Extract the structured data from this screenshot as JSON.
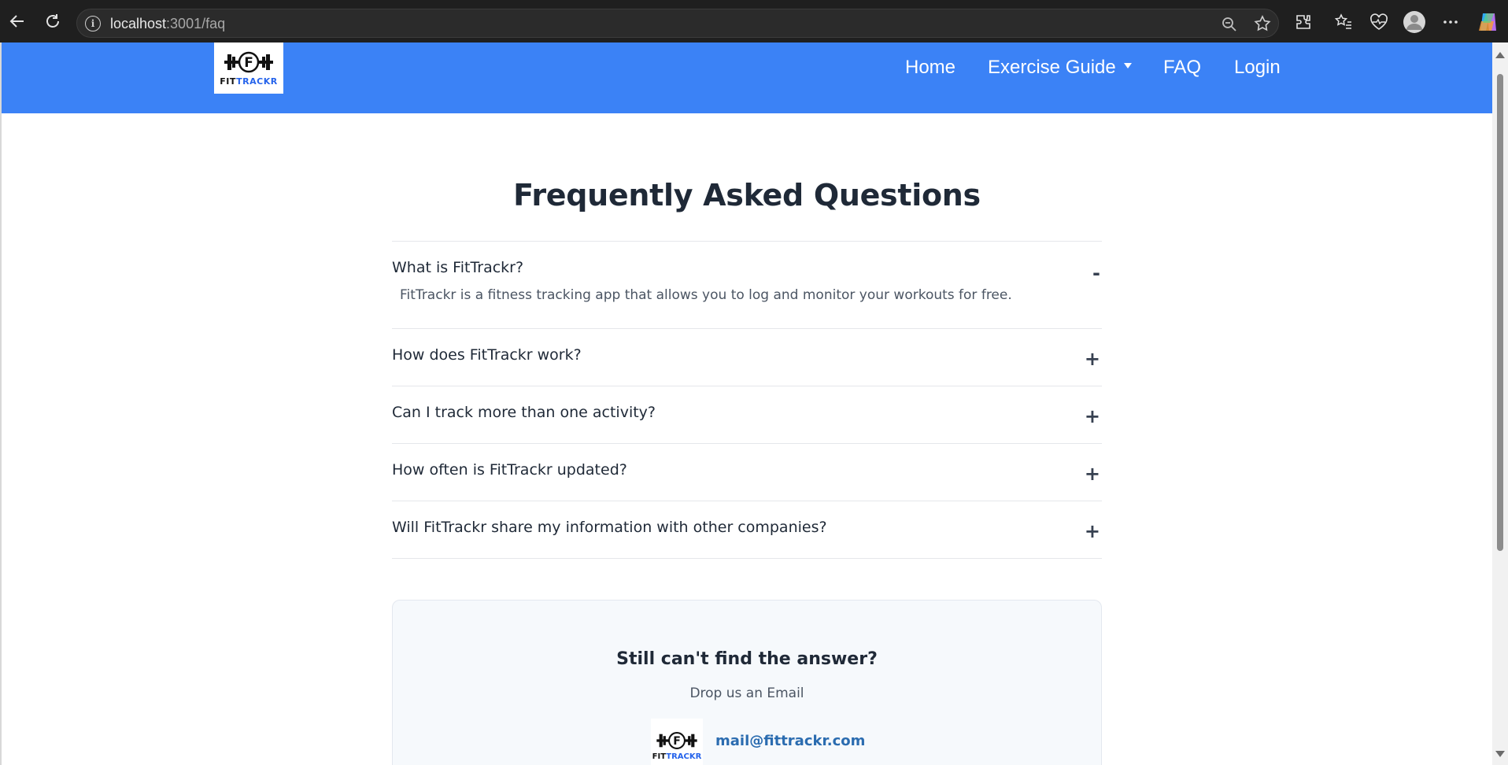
{
  "browser": {
    "url_host": "localhost",
    "url_path": ":3001/faq",
    "icons": [
      "back-icon",
      "reload-icon",
      "info-icon",
      "zoom-icon",
      "favorite-star-icon",
      "extensions-icon",
      "favorites-list-icon",
      "health-icon",
      "profile-icon",
      "more-icon",
      "copilot-icon"
    ]
  },
  "header": {
    "logo": {
      "fit": "FIT",
      "trackr": "TRACKR",
      "letter": "F"
    },
    "nav": {
      "home": "Home",
      "exercise_guide": "Exercise Guide",
      "faq": "FAQ",
      "login": "Login"
    },
    "bg_color": "#3b82f6"
  },
  "faq": {
    "title": "Frequently Asked Questions",
    "items": [
      {
        "question": "What is FitTrackr?",
        "answer": "FitTrackr is a fitness tracking app that allows you to log and monitor your workouts for free.",
        "toggle": "-",
        "open": true
      },
      {
        "question": "How does FitTrackr work?",
        "toggle": "+",
        "open": false
      },
      {
        "question": "Can I track more than one activity?",
        "toggle": "+",
        "open": false
      },
      {
        "question": "How often is FitTrackr updated?",
        "toggle": "+",
        "open": false
      },
      {
        "question": "Will FitTrackr share my information with other companies?",
        "toggle": "+",
        "open": false
      }
    ]
  },
  "contact": {
    "title": "Still can't find the answer?",
    "subtitle": "Drop us an Email",
    "email": "mail@fittrackr.com",
    "logo": {
      "fit": "FIT",
      "trackr": "TRACKR",
      "letter": "F"
    }
  }
}
